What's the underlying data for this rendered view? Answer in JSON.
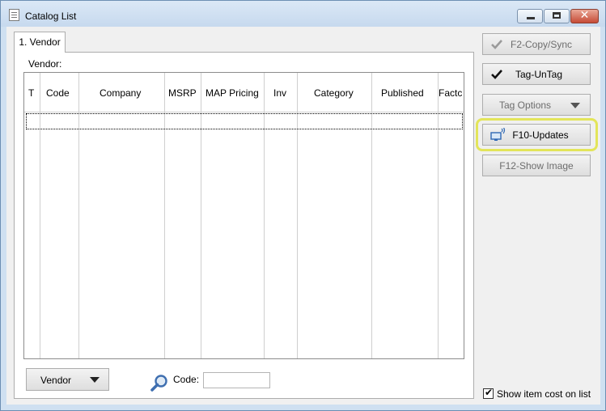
{
  "window": {
    "title": "Catalog List",
    "close_glyph": "✕"
  },
  "tab": {
    "label": "1. Vendor"
  },
  "vendor_label": "Vendor:",
  "grid": {
    "columns": [
      "T",
      "Code",
      "Company",
      "MSRP",
      "MAP Pricing",
      "Inv",
      "Category",
      "Published",
      "Factc"
    ]
  },
  "bottom": {
    "vendor_button": "Vendor",
    "code_label": "Code:",
    "code_value": ""
  },
  "side_buttons": {
    "copy_sync": "F2-Copy/Sync",
    "tag_untag": "Tag-UnTag",
    "tag_options": "Tag Options",
    "updates": "F10-Updates",
    "show_image": "F12-Show Image"
  },
  "show_item_cost": {
    "label": "Show item cost on list",
    "checked": true,
    "mark": "✔"
  },
  "icons": [
    "app-icon",
    "search-icon",
    "checkmark-icon",
    "computer-wireless-icon",
    "chevron-down-icon"
  ]
}
